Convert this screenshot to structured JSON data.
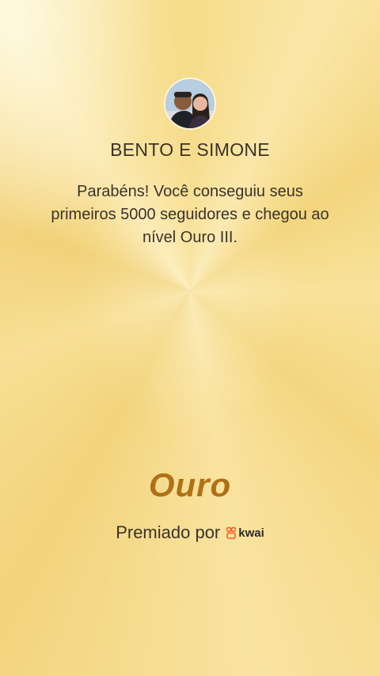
{
  "profile": {
    "name": "BENTO E SIMONE",
    "avatar_icon": "couple-photo"
  },
  "message": "Parabéns! Você conseguiu seus primeiros 5000 seguidores e chegou ao nível Ouro III.",
  "level": {
    "title": "Ouro",
    "color": "#b07016"
  },
  "footer": {
    "awarded_by": "Premiado por",
    "brand_name": "kwai",
    "brand_icon": "kwai-logo-icon",
    "brand_color": "#ff5a1f"
  },
  "colors": {
    "background": "#f6dc8a",
    "text": "#3a3328"
  }
}
